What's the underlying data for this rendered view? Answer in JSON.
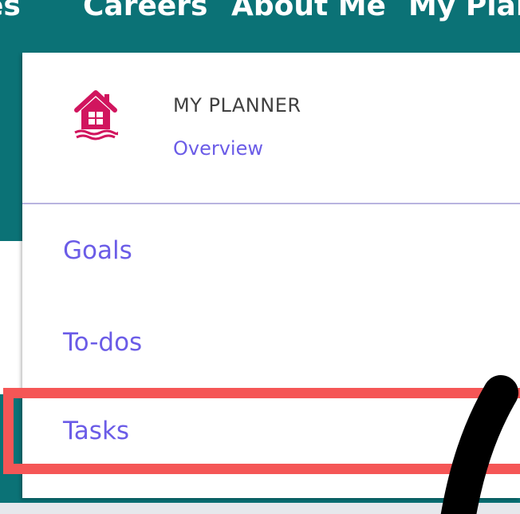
{
  "topnav": {
    "items": [
      {
        "label": "es"
      },
      {
        "label": "Careers"
      },
      {
        "label": "About Me"
      },
      {
        "label": "My Plann"
      }
    ]
  },
  "dropdown": {
    "title": "MY PLANNER",
    "overview_label": "Overview",
    "items": [
      {
        "label": "Goals"
      },
      {
        "label": "To-dos"
      },
      {
        "label": "Tasks"
      }
    ]
  },
  "icons": {
    "header_icon": "home-icon"
  },
  "colors": {
    "nav_teal": "#0b7276",
    "link_purple": "#6b5ce7",
    "icon_pink": "#d1155e",
    "highlight_red": "#f55656"
  }
}
